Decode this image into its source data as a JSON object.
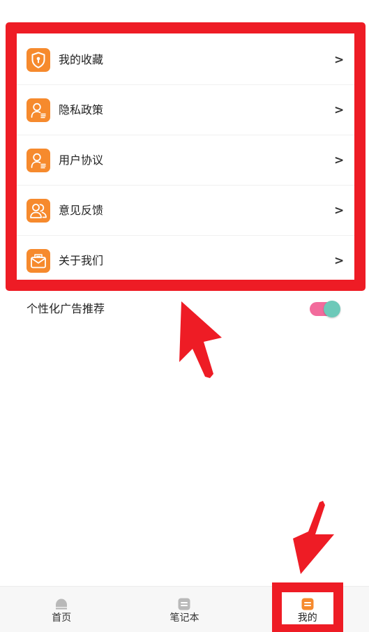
{
  "menu": {
    "items": [
      {
        "label": "我的收藏",
        "icon": "shield-icon"
      },
      {
        "label": "隐私政策",
        "icon": "user-doc-icon"
      },
      {
        "label": "用户协议",
        "icon": "user-doc-icon"
      },
      {
        "label": "意见反馈",
        "icon": "users-icon"
      },
      {
        "label": "关于我们",
        "icon": "mail-icon"
      }
    ],
    "chevron": ">"
  },
  "ad_toggle": {
    "label": "个性化广告推荐",
    "on": true
  },
  "tabbar": {
    "tabs": [
      {
        "label": "首页",
        "icon": "home-icon",
        "active": false
      },
      {
        "label": "笔记本",
        "icon": "notebook-icon",
        "active": false
      },
      {
        "label": "我的",
        "icon": "profile-icon",
        "active": true
      }
    ]
  },
  "colors": {
    "accent": "#F68A2D",
    "annotation": "#EE1C25",
    "toggle_track": "#F26B9C",
    "toggle_knob": "#6DC9B9",
    "tab_inactive": "#B9B9B9"
  }
}
